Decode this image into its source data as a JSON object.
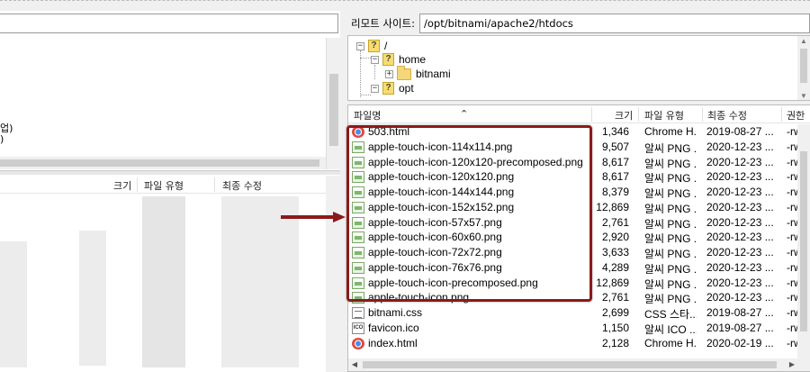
{
  "remote": {
    "label": "리모트 사이트:",
    "path": "/opt/bitnami/apache2/htdocs",
    "tree": [
      {
        "label": "/",
        "icon": "question-folder-icon",
        "expander": "−"
      },
      {
        "label": "home",
        "icon": "question-folder-icon",
        "expander": "−"
      },
      {
        "label": "bitnami",
        "icon": "folder-icon",
        "expander": "+"
      },
      {
        "label": "opt",
        "icon": "question-folder-icon",
        "expander": "−"
      }
    ],
    "columns": {
      "name": "파일명",
      "size": "크기",
      "type": "파일 유형",
      "modified": "최종 수정",
      "perm": "권한"
    },
    "files": [
      {
        "name": "503.html",
        "size": "1,346",
        "type": "Chrome H...",
        "date": "2019-08-27 ...",
        "perm": "-rw",
        "icon": "html-icon"
      },
      {
        "name": "apple-touch-icon-114x114.png",
        "size": "9,507",
        "type": "알씨 PNG ...",
        "date": "2020-12-23 ...",
        "perm": "-rw",
        "icon": "png-icon"
      },
      {
        "name": "apple-touch-icon-120x120-precomposed.png",
        "size": "8,617",
        "type": "알씨 PNG ...",
        "date": "2020-12-23 ...",
        "perm": "-rw",
        "icon": "png-icon"
      },
      {
        "name": "apple-touch-icon-120x120.png",
        "size": "8,617",
        "type": "알씨 PNG ...",
        "date": "2020-12-23 ...",
        "perm": "-rw",
        "icon": "png-icon"
      },
      {
        "name": "apple-touch-icon-144x144.png",
        "size": "8,379",
        "type": "알씨 PNG ...",
        "date": "2020-12-23 ...",
        "perm": "-rw",
        "icon": "png-icon"
      },
      {
        "name": "apple-touch-icon-152x152.png",
        "size": "12,869",
        "type": "알씨 PNG ...",
        "date": "2020-12-23 ...",
        "perm": "-rw",
        "icon": "png-icon"
      },
      {
        "name": "apple-touch-icon-57x57.png",
        "size": "2,761",
        "type": "알씨 PNG ...",
        "date": "2020-12-23 ...",
        "perm": "-rw",
        "icon": "png-icon"
      },
      {
        "name": "apple-touch-icon-60x60.png",
        "size": "2,920",
        "type": "알씨 PNG ...",
        "date": "2020-12-23 ...",
        "perm": "-rw",
        "icon": "png-icon"
      },
      {
        "name": "apple-touch-icon-72x72.png",
        "size": "3,633",
        "type": "알씨 PNG ...",
        "date": "2020-12-23 ...",
        "perm": "-rw",
        "icon": "png-icon"
      },
      {
        "name": "apple-touch-icon-76x76.png",
        "size": "4,289",
        "type": "알씨 PNG ...",
        "date": "2020-12-23 ...",
        "perm": "-rw",
        "icon": "png-icon"
      },
      {
        "name": "apple-touch-icon-precomposed.png",
        "size": "12,869",
        "type": "알씨 PNG ...",
        "date": "2020-12-23 ...",
        "perm": "-rw",
        "icon": "png-icon"
      },
      {
        "name": "apple-touch-icon.png",
        "size": "2,761",
        "type": "알씨 PNG ...",
        "date": "2020-12-23 ...",
        "perm": "-rw",
        "icon": "png-icon"
      },
      {
        "name": "bitnami.css",
        "size": "2,699",
        "type": "CSS 스타...",
        "date": "2019-08-27 ...",
        "perm": "-rw",
        "icon": "css-icon"
      },
      {
        "name": "favicon.ico",
        "size": "1,150",
        "type": "알씨 ICO ...",
        "date": "2019-08-27 ...",
        "perm": "-rw",
        "icon": "ico-icon"
      },
      {
        "name": "index.html",
        "size": "2,128",
        "type": "Chrome H...",
        "date": "2020-02-19 ...",
        "perm": "-rw",
        "icon": "html-icon"
      }
    ]
  },
  "local": {
    "tree_fragments": [
      "업)",
      ")"
    ],
    "columns": {
      "size": "크기",
      "type": "파일 유형",
      "modified": "최종 수정"
    }
  },
  "annotation": {
    "color": "#8b1a1a"
  }
}
